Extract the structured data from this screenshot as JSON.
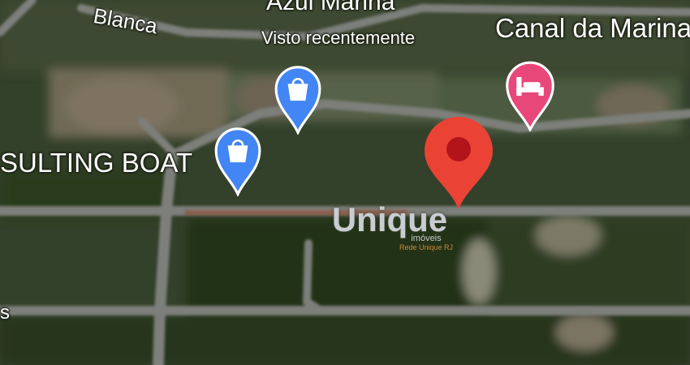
{
  "map": {
    "labels": {
      "road_blanca": "Blanca",
      "place_azul": "Azul Marina",
      "place_azul_sub": "Visto recentemente",
      "place_canal": "Canal da Marina",
      "place_boat": "SULTING BOAT",
      "left_edge": "s"
    },
    "pins": {
      "shopping_1": {
        "icon": "shopping-bag-icon",
        "color": "#4285f4"
      },
      "shopping_2": {
        "icon": "shopping-bag-icon",
        "color": "#4285f4"
      },
      "hotel": {
        "icon": "bed-icon",
        "color": "#e8477a"
      },
      "selected": {
        "icon": "location-pin-icon",
        "color": "#ea4335"
      }
    },
    "watermark": {
      "brand": "Unique",
      "sub": "imóveis",
      "tiny": "Rede Unique RJ"
    }
  }
}
